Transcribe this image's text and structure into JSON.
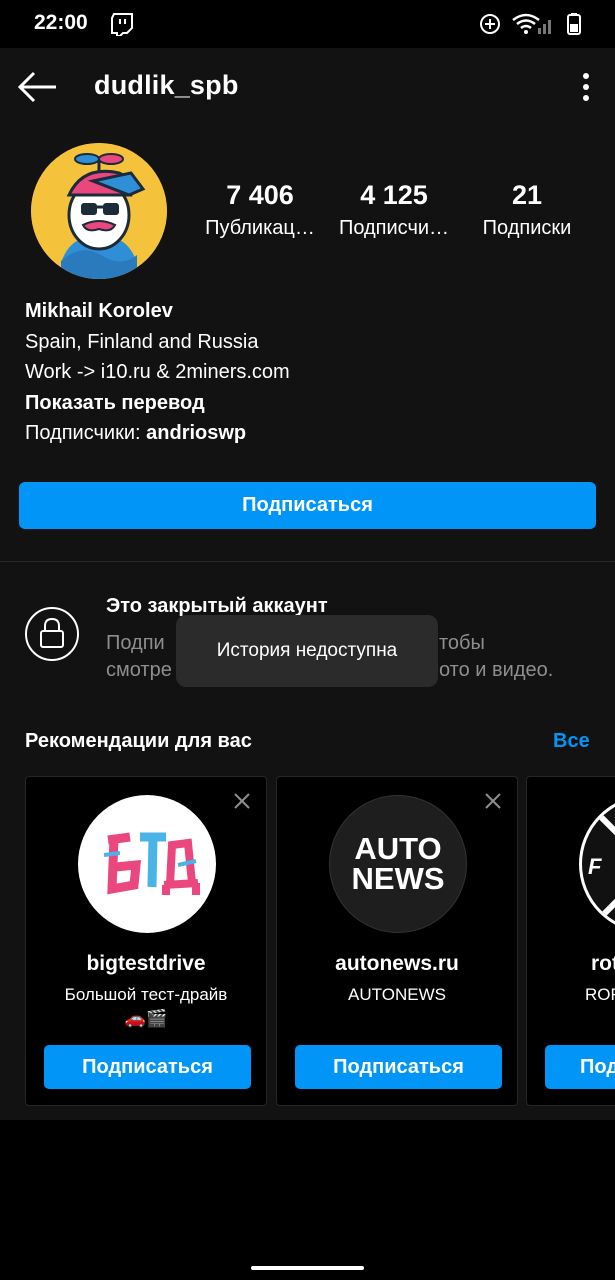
{
  "status_bar": {
    "time": "22:00"
  },
  "header": {
    "username": "dudlik_spb"
  },
  "profile": {
    "stats": [
      {
        "number": "7 406",
        "label": "Публикац…"
      },
      {
        "number": "4 125",
        "label": "Подписчи…"
      },
      {
        "number": "21",
        "label": "Подписки"
      }
    ],
    "name": "Mikhail Korolev",
    "bio_line1": "Spain, Finland and Russia",
    "bio_line2": "Work -> i10.ru & 2miners.com",
    "translate": "Показать перевод",
    "followers_prefix": "Подписчики: ",
    "followers_user": "andrioswp",
    "follow_label": "Подписаться"
  },
  "private": {
    "title": "Это закрытый аккаунт",
    "desc_line1": "Подпи",
    "desc_line1_end": "тобы",
    "desc_line2": "смотре",
    "desc_line2_end": "ото и видео."
  },
  "toast": {
    "text": "История недоступна"
  },
  "recommendations": {
    "title": "Рекомендации для вас",
    "all_label": "Все",
    "cards": [
      {
        "name": "bigtestdrive",
        "subtitle": "Большой тест-драйв",
        "emoji": "🚗🎬",
        "button": "Подписаться"
      },
      {
        "name": "autonews.ru",
        "subtitle": "AUTONEWS",
        "logo_text_1": "AUTO",
        "logo_text_2": "NEWS",
        "button": "Подписаться"
      },
      {
        "name": "rot",
        "subtitle": "ROR",
        "button": "Подп"
      }
    ]
  },
  "colors": {
    "accent": "#0095f6",
    "background": "#121212"
  }
}
